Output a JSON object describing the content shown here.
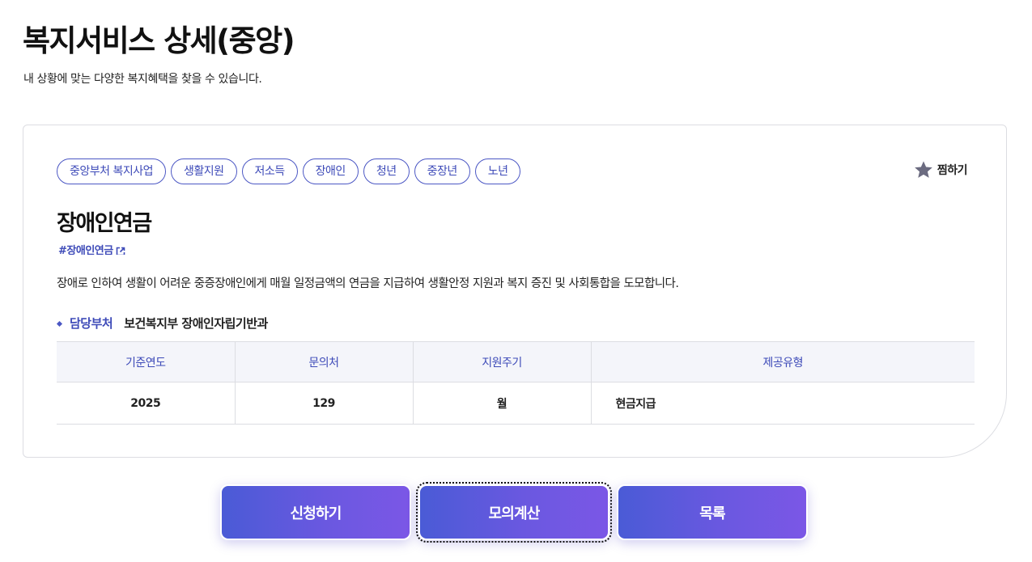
{
  "page": {
    "title": "복지서비스 상세(중앙)",
    "subtitle": "내 상황에 맞는 다양한 복지혜택을 찾을 수 있습니다."
  },
  "tags": [
    "중앙부처 복지사업",
    "생활지원",
    "저소득",
    "장애인",
    "청년",
    "중장년",
    "노년"
  ],
  "bookmark": {
    "label": "찜하기",
    "icon": "star-icon"
  },
  "service": {
    "title": "장애인연금",
    "hashtag": "#장애인연금",
    "description": "장애로 인하여 생활이 어려운 중증장애인에게 매월 일정금액의 연금을 지급하여 생활안정 지원과 복지 증진 및 사회통합을 도모합니다."
  },
  "department": {
    "label": "담당부처",
    "value": "보건복지부 장애인자립기반과"
  },
  "table": {
    "headers": [
      "기준연도",
      "문의처",
      "지원주기",
      "제공유형"
    ],
    "row": [
      "2025",
      "129",
      "월",
      "현금지급"
    ]
  },
  "actions": {
    "apply": "신청하기",
    "simulate": "모의계산",
    "list": "목록"
  },
  "colors": {
    "accent": "#3d4ab8",
    "button_gradient_start": "#4a5bd6",
    "button_gradient_end": "#7b57e6",
    "table_header_bg": "#f4f5fa",
    "star": "#6b6b80"
  }
}
